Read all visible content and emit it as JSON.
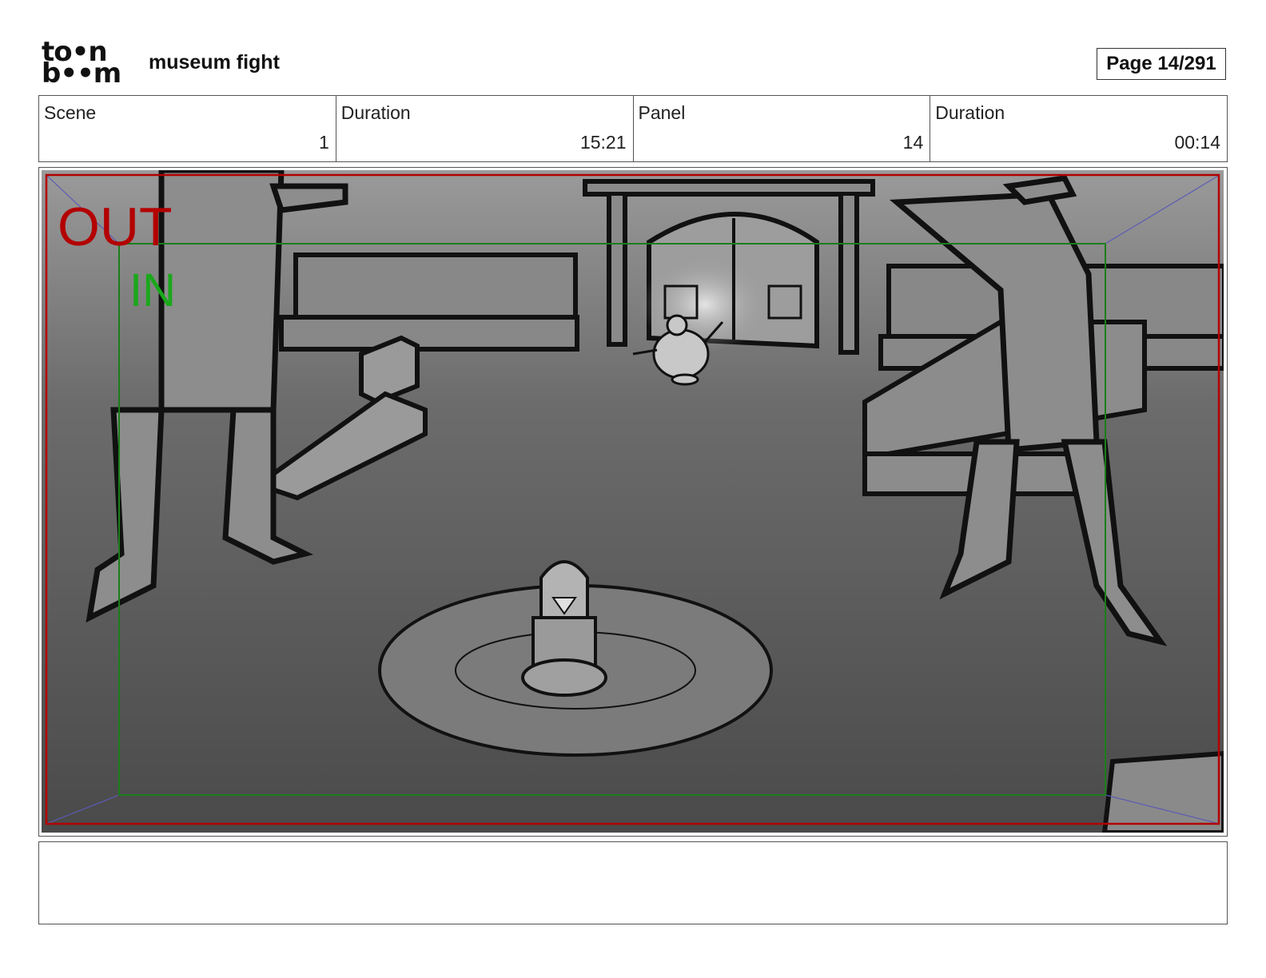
{
  "header": {
    "logo_line1": "to•n",
    "logo_line2": "b••m",
    "project_title": "museum fight",
    "page_label": "Page  14/291"
  },
  "info": {
    "scene_label": "Scene",
    "scene_value": "1",
    "scene_duration_label": "Duration",
    "scene_duration_value": "15:21",
    "panel_label": "Panel",
    "panel_value": "14",
    "panel_duration_label": "Duration",
    "panel_duration_value": "00:14"
  },
  "panel": {
    "out_label": "OUT",
    "in_label": "IN",
    "out_color": "#b30000",
    "in_color": "#1aa81a"
  },
  "notes": {
    "text": ""
  }
}
